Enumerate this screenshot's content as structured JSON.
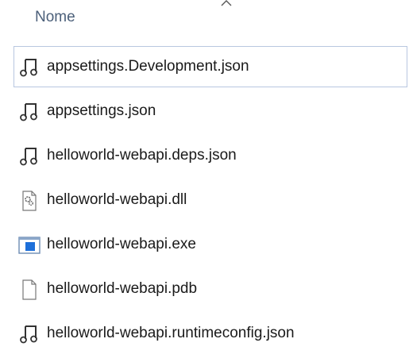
{
  "header": {
    "name_column_label": "Nome"
  },
  "files": [
    {
      "name": "appsettings.Development.json",
      "icon": "json-file-icon"
    },
    {
      "name": "appsettings.json",
      "icon": "json-file-icon"
    },
    {
      "name": "helloworld-webapi.deps.json",
      "icon": "json-file-icon"
    },
    {
      "name": "helloworld-webapi.dll",
      "icon": "dll-file-icon"
    },
    {
      "name": "helloworld-webapi.exe",
      "icon": "exe-file-icon"
    },
    {
      "name": "helloworld-webapi.pdb",
      "icon": "blank-file-icon"
    },
    {
      "name": "helloworld-webapi.runtimeconfig.json",
      "icon": "json-file-icon"
    }
  ],
  "colors": {
    "header_text": "#4c607a",
    "focus_border": "#b8c7e0",
    "exe_blue": "#1e6fd9"
  }
}
